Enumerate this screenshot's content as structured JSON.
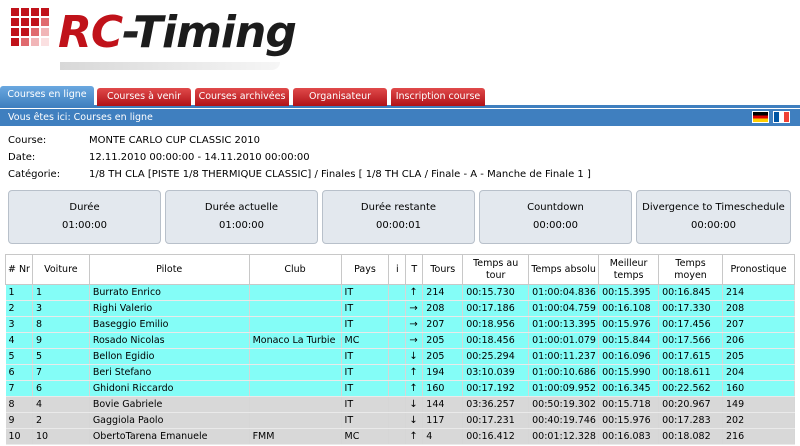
{
  "brand": {
    "rc": "RC",
    "dash": "-",
    "timing": "Timing"
  },
  "tabs": [
    {
      "label": "Courses en ligne",
      "active": true
    },
    {
      "label": "Courses à venir",
      "active": false
    },
    {
      "label": "Courses archivées",
      "active": false
    },
    {
      "label": "Organisateur",
      "active": false
    },
    {
      "label": "Inscription course",
      "active": false
    }
  ],
  "breadcrumb": "Vous êtes ici: Courses en ligne",
  "info": {
    "course_label": "Course:",
    "course_value": "MONTE CARLO CUP CLASSIC 2010",
    "date_label": "Date:",
    "date_value": "12.11.2010 00:00:00 - 14.11.2010 00:00:00",
    "categorie_label": "Catégorie:",
    "categorie_value": "1/8 TH CLA [PISTE 1/8 THERMIQUE CLASSIC] / Finales [ 1/8 TH CLA / Finale - A - Manche de Finale 1 ]"
  },
  "timers": [
    {
      "label": "Durée",
      "value": "01:00:00"
    },
    {
      "label": "Durée actuelle",
      "value": "01:00:00"
    },
    {
      "label": "Durée restante",
      "value": "00:00:01"
    },
    {
      "label": "Countdown",
      "value": "00:00:00"
    },
    {
      "label": "Divergence to Timeschedule",
      "value": "00:00:00"
    }
  ],
  "table": {
    "headers": [
      "# Nr",
      "Voiture",
      "Pilote",
      "Club",
      "Pays",
      "i",
      "T",
      "Tours",
      "Temps au tour",
      "Temps absolu",
      "Meilleur temps",
      "Temps moyen",
      "Pronostique"
    ],
    "rows": [
      {
        "pos": "1",
        "car": "1",
        "pilot": "Burrato Enrico",
        "club": "",
        "country": "IT",
        "trend": "↑",
        "laps": "214",
        "lap_time": "00:15.730",
        "abs_time": "01:00:04.836",
        "best": "00:15.395",
        "avg": "00:16.845",
        "prog": "214",
        "style": "cyan"
      },
      {
        "pos": "2",
        "car": "3",
        "pilot": "Righi Valerio",
        "club": "",
        "country": "IT",
        "trend": "→",
        "laps": "208",
        "lap_time": "00:17.186",
        "abs_time": "01:00:04.759",
        "best": "00:16.108",
        "avg": "00:17.330",
        "prog": "208",
        "style": "cyan"
      },
      {
        "pos": "3",
        "car": "8",
        "pilot": "Baseggio Emilio",
        "club": "",
        "country": "IT",
        "trend": "→",
        "laps": "207",
        "lap_time": "00:18.956",
        "abs_time": "01:00:13.395",
        "best": "00:15.976",
        "avg": "00:17.456",
        "prog": "207",
        "style": "cyan"
      },
      {
        "pos": "4",
        "car": "9",
        "pilot": "Rosado Nicolas",
        "club": "Monaco La Turbie",
        "country": "MC",
        "trend": "→",
        "laps": "205",
        "lap_time": "00:18.456",
        "abs_time": "01:00:01.079",
        "best": "00:15.844",
        "avg": "00:17.566",
        "prog": "206",
        "style": "cyan"
      },
      {
        "pos": "5",
        "car": "5",
        "pilot": "Bellon Egidio",
        "club": "",
        "country": "IT",
        "trend": "↓",
        "laps": "205",
        "lap_time": "00:25.294",
        "abs_time": "01:00:11.237",
        "best": "00:16.096",
        "avg": "00:17.615",
        "prog": "205",
        "style": "cyan"
      },
      {
        "pos": "6",
        "car": "7",
        "pilot": "Beri Stefano",
        "club": "",
        "country": "IT",
        "trend": "↑",
        "laps": "194",
        "lap_time": "03:10.039",
        "abs_time": "01:00:10.686",
        "best": "00:15.990",
        "avg": "00:18.611",
        "prog": "204",
        "style": "cyan"
      },
      {
        "pos": "7",
        "car": "6",
        "pilot": "Ghidoni Riccardo",
        "club": "",
        "country": "IT",
        "trend": "↑",
        "laps": "160",
        "lap_time": "00:17.192",
        "abs_time": "01:00:09.952",
        "best": "00:16.345",
        "avg": "00:22.562",
        "prog": "160",
        "style": "cyan"
      },
      {
        "pos": "8",
        "car": "4",
        "pilot": "Bovie Gabriele",
        "club": "",
        "country": "IT",
        "trend": "↓",
        "laps": "144",
        "lap_time": "03:36.257",
        "abs_time": "00:50:19.302",
        "best": "00:15.718",
        "avg": "00:20.967",
        "prog": "149",
        "style": "grey"
      },
      {
        "pos": "9",
        "car": "2",
        "pilot": "Gaggiola Paolo",
        "club": "",
        "country": "IT",
        "trend": "↓",
        "laps": "117",
        "lap_time": "00:17.231",
        "abs_time": "00:40:19.746",
        "best": "00:15.976",
        "avg": "00:17.283",
        "prog": "202",
        "style": "grey"
      },
      {
        "pos": "10",
        "car": "10",
        "pilot": "ObertoTarena Emanuele",
        "club": "FMM",
        "country": "MC",
        "trend": "↑",
        "laps": "4",
        "lap_time": "00:16.412",
        "abs_time": "00:01:12.328",
        "best": "00:16.083",
        "avg": "00:18.082",
        "prog": "216",
        "style": "grey"
      }
    ]
  },
  "colors": {
    "brand_red": "#c0121a",
    "tab_blue": "#3f7fbf",
    "row_cyan": "#84fdf7",
    "row_grey": "#d8d8d8"
  }
}
